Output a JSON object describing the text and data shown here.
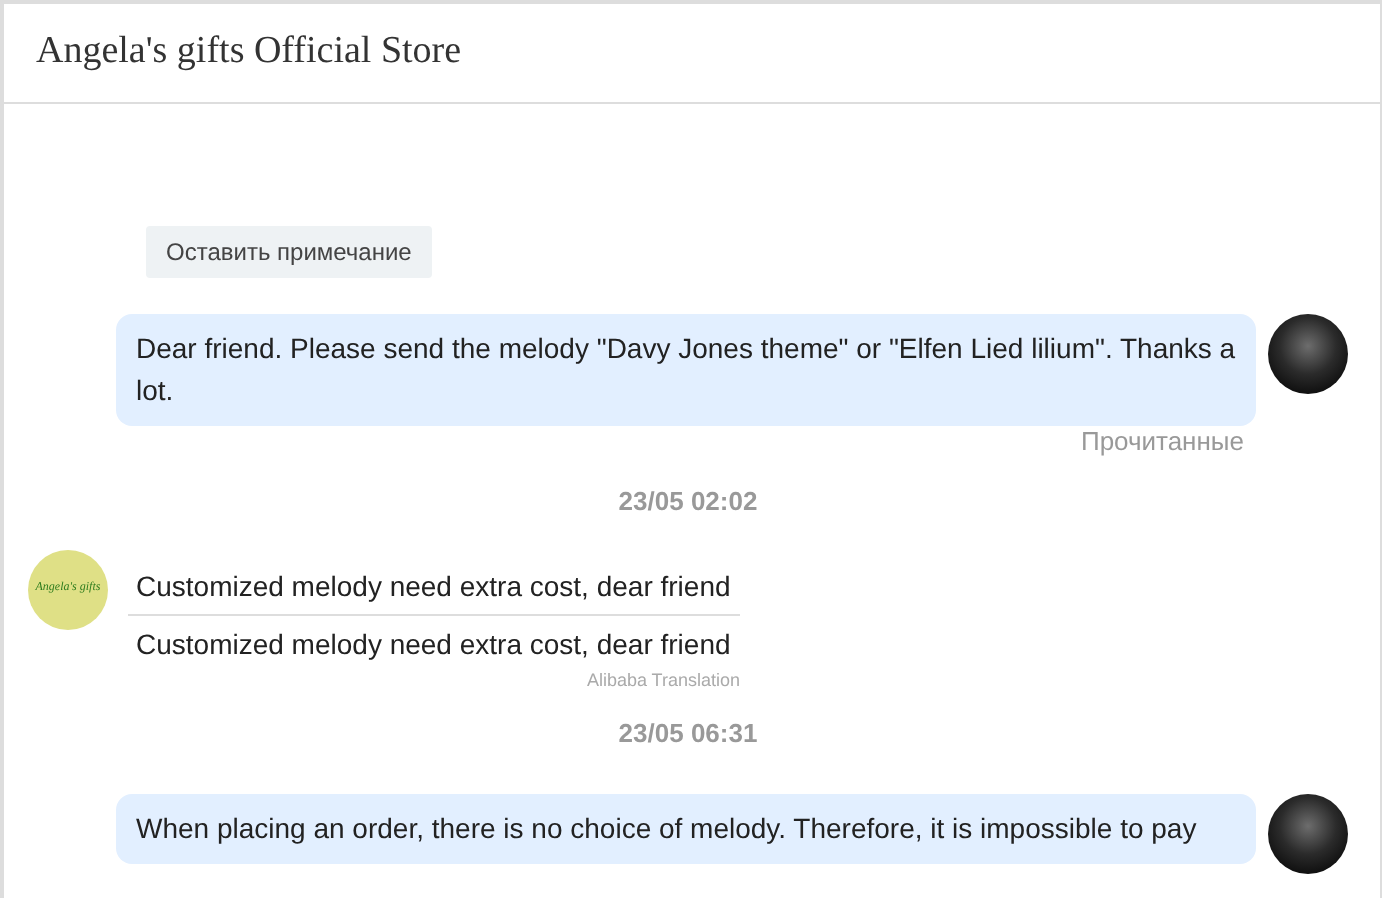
{
  "window": {
    "title": "Angela's gifts Official Store"
  },
  "note_button": {
    "label": "Оставить примечание"
  },
  "messages": [
    {
      "kind": "outgoing",
      "text": "Dear friend. Please send the melody \"Davy Jones theme\" or \"Elfen Lied lilium\". Thanks a lot.",
      "status": "Прочитанные"
    },
    {
      "kind": "timestamp",
      "text": "23/05 02:02"
    },
    {
      "kind": "incoming",
      "avatar_label": "Angela's gifts",
      "text": "Customized melody need extra cost, dear friend",
      "translation": "Customized melody need extra cost, dear friend",
      "translation_credit": "Alibaba Translation"
    },
    {
      "kind": "timestamp",
      "text": "23/05 06:31"
    },
    {
      "kind": "outgoing",
      "text": "When placing an order, there is no choice of melody. Therefore, it is impossible to pay"
    }
  ]
}
